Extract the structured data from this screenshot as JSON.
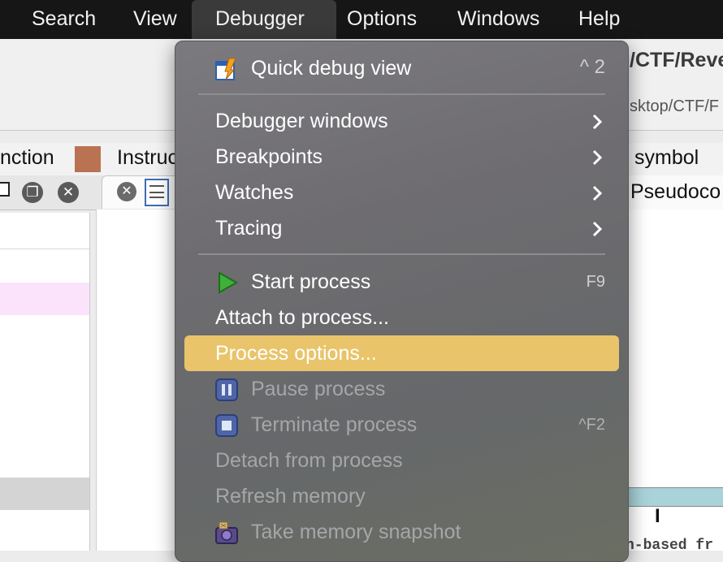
{
  "menubar": {
    "items": [
      "Search",
      "View",
      "Debugger",
      "Options",
      "Windows",
      "Help"
    ]
  },
  "background": {
    "path_title": "/CTF/Reve",
    "path_subtitle": "sktop/CTF/F",
    "legend_function": "nction",
    "legend_instruction": "Instruc",
    "legend_symbol": "symbol",
    "legend_swatch_color": "#b97252",
    "tab_pseudocode": "Pseudoco",
    "bottom_code_fragment": "n-based fr",
    "cursor_mark": "I"
  },
  "menu": {
    "quick_debug_view": {
      "label": "Quick debug view",
      "shortcut": "^ 2",
      "icon": "quick-debug-icon"
    },
    "debugger_windows": {
      "label": "Debugger windows"
    },
    "breakpoints": {
      "label": "Breakpoints"
    },
    "watches": {
      "label": "Watches"
    },
    "tracing": {
      "label": "Tracing"
    },
    "start_process": {
      "label": "Start process",
      "shortcut": "F9",
      "icon": "play-icon"
    },
    "attach_process": {
      "label": "Attach to process..."
    },
    "process_options": {
      "label": "Process options..."
    },
    "pause_process": {
      "label": "Pause process",
      "icon": "pause-icon"
    },
    "terminate_process": {
      "label": "Terminate process",
      "shortcut": "^F2",
      "icon": "stop-icon"
    },
    "detach_process": {
      "label": "Detach from process"
    },
    "refresh_memory": {
      "label": "Refresh memory"
    },
    "take_snapshot": {
      "label": "Take memory snapshot",
      "icon": "snapshot-icon"
    }
  },
  "colors": {
    "highlight": "#e9c46a",
    "menubar_bg": "#161616",
    "menu_bg": "#707073"
  }
}
